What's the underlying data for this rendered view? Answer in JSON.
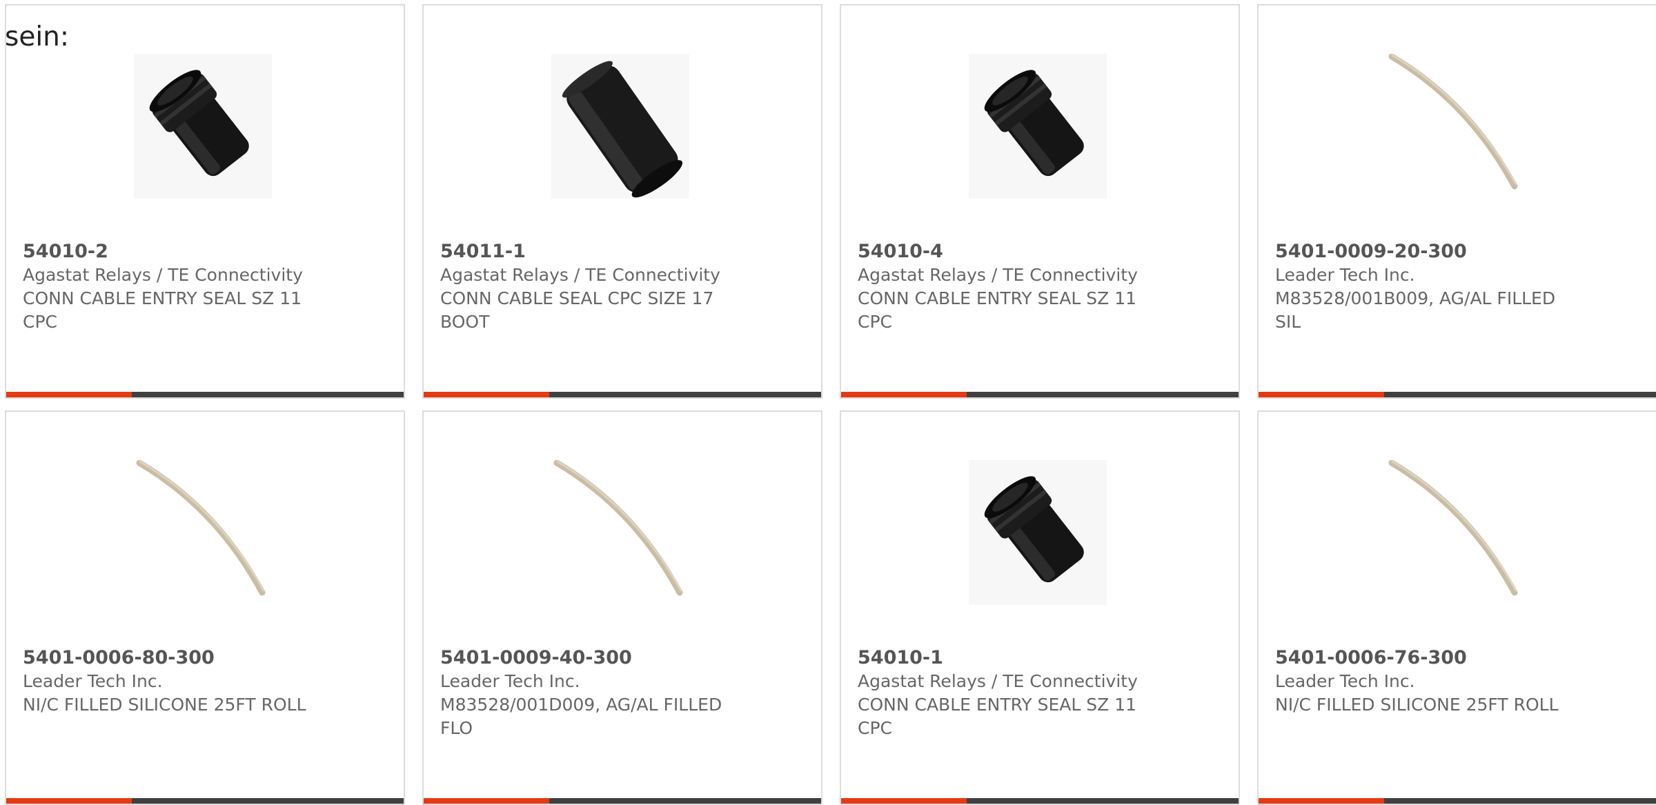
{
  "intro_text": "sein:",
  "colors": {
    "accent": "#e63a12",
    "bar": "#404040",
    "border": "#dcdcdc"
  },
  "products": [
    {
      "part_number": "54010-2",
      "manufacturer": "Agastat Relays / TE Connectivity",
      "description": "CONN CABLE ENTRY SEAL SZ 11 CPC",
      "image_icon": "black-short-seal-image"
    },
    {
      "part_number": "54011-1",
      "manufacturer": "Agastat Relays / TE Connectivity",
      "description": "CONN CABLE SEAL CPC SIZE 17 BOOT",
      "image_icon": "black-boot-image"
    },
    {
      "part_number": "54010-4",
      "manufacturer": "Agastat Relays / TE Connectivity",
      "description": "CONN CABLE ENTRY SEAL SZ 11 CPC",
      "image_icon": "black-short-seal-image"
    },
    {
      "part_number": "5401-0009-20-300",
      "manufacturer": "Leader Tech Inc.",
      "description": "M83528/001B009, AG/AL FILLED SIL",
      "image_icon": "beige-cord-image"
    },
    {
      "part_number": "5401-0006-80-300",
      "manufacturer": "Leader Tech Inc.",
      "description": "NI/C FILLED SILICONE 25FT ROLL",
      "image_icon": "beige-cord-image"
    },
    {
      "part_number": "5401-0009-40-300",
      "manufacturer": "Leader Tech Inc.",
      "description": "M83528/001D009, AG/AL FILLED FLO",
      "image_icon": "beige-cord-image"
    },
    {
      "part_number": "54010-1",
      "manufacturer": "Agastat Relays / TE Connectivity",
      "description": "CONN CABLE ENTRY SEAL SZ 11 CPC",
      "image_icon": "black-short-seal-image"
    },
    {
      "part_number": "5401-0006-76-300",
      "manufacturer": "Leader Tech Inc.",
      "description": "NI/C FILLED SILICONE 25FT ROLL",
      "image_icon": "beige-cord-image"
    }
  ]
}
